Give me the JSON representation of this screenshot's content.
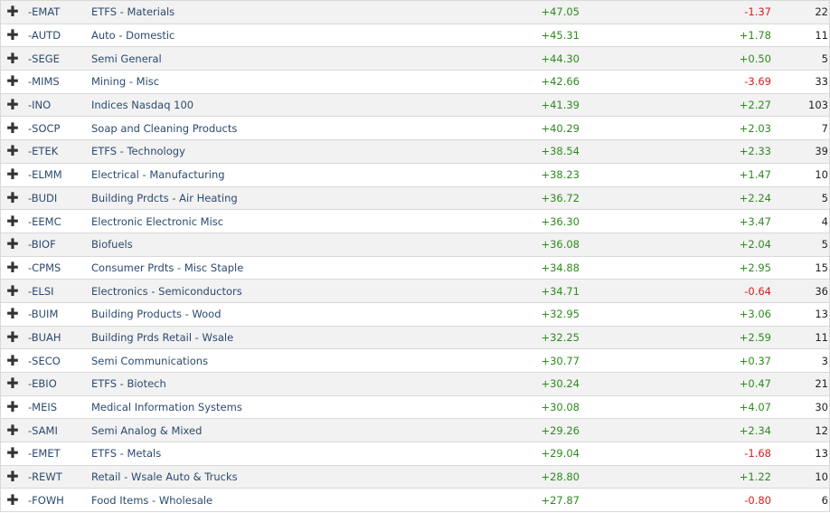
{
  "rows": [
    {
      "symbol": "-EMAT",
      "name": "ETFS - Materials",
      "chg1": "+47.05",
      "chg2": "-1.37",
      "count": "22"
    },
    {
      "symbol": "-AUTD",
      "name": "Auto - Domestic",
      "chg1": "+45.31",
      "chg2": "+1.78",
      "count": "11"
    },
    {
      "symbol": "-SEGE",
      "name": "Semi General",
      "chg1": "+44.30",
      "chg2": "+0.50",
      "count": "5"
    },
    {
      "symbol": "-MIMS",
      "name": "Mining - Misc",
      "chg1": "+42.66",
      "chg2": "-3.69",
      "count": "33"
    },
    {
      "symbol": "-INO",
      "name": "Indices Nasdaq 100",
      "chg1": "+41.39",
      "chg2": "+2.27",
      "count": "103"
    },
    {
      "symbol": "-SOCP",
      "name": "Soap and Cleaning Products",
      "chg1": "+40.29",
      "chg2": "+2.03",
      "count": "7"
    },
    {
      "symbol": "-ETEK",
      "name": "ETFS - Technology",
      "chg1": "+38.54",
      "chg2": "+2.33",
      "count": "39"
    },
    {
      "symbol": "-ELMM",
      "name": "Electrical - Manufacturing",
      "chg1": "+38.23",
      "chg2": "+1.47",
      "count": "10"
    },
    {
      "symbol": "-BUDI",
      "name": "Building Prdcts - Air Heating",
      "chg1": "+36.72",
      "chg2": "+2.24",
      "count": "5"
    },
    {
      "symbol": "-EEMC",
      "name": "Electronic Electronic Misc",
      "chg1": "+36.30",
      "chg2": "+3.47",
      "count": "4"
    },
    {
      "symbol": "-BIOF",
      "name": "Biofuels",
      "chg1": "+36.08",
      "chg2": "+2.04",
      "count": "5"
    },
    {
      "symbol": "-CPMS",
      "name": "Consumer Prdts - Misc Staple",
      "chg1": "+34.88",
      "chg2": "+2.95",
      "count": "15"
    },
    {
      "symbol": "-ELSI",
      "name": "Electronics - Semiconductors",
      "chg1": "+34.71",
      "chg2": "-0.64",
      "count": "36"
    },
    {
      "symbol": "-BUIM",
      "name": "Building Products - Wood",
      "chg1": "+32.95",
      "chg2": "+3.06",
      "count": "13"
    },
    {
      "symbol": "-BUAH",
      "name": "Building Prds Retail - Wsale",
      "chg1": "+32.25",
      "chg2": "+2.59",
      "count": "11"
    },
    {
      "symbol": "-SECO",
      "name": "Semi Communications",
      "chg1": "+30.77",
      "chg2": "+0.37",
      "count": "3"
    },
    {
      "symbol": "-EBIO",
      "name": "ETFS - Biotech",
      "chg1": "+30.24",
      "chg2": "+0.47",
      "count": "21"
    },
    {
      "symbol": "-MEIS",
      "name": "Medical Information Systems",
      "chg1": "+30.08",
      "chg2": "+4.07",
      "count": "30"
    },
    {
      "symbol": "-SAMI",
      "name": "Semi Analog & Mixed",
      "chg1": "+29.26",
      "chg2": "+2.34",
      "count": "12"
    },
    {
      "symbol": "-EMET",
      "name": "ETFS - Metals",
      "chg1": "+29.04",
      "chg2": "-1.68",
      "count": "13"
    },
    {
      "symbol": "-REWT",
      "name": "Retail - Wsale Auto & Trucks",
      "chg1": "+28.80",
      "chg2": "+1.22",
      "count": "10"
    },
    {
      "symbol": "-FOWH",
      "name": "Food Items - Wholesale",
      "chg1": "+27.87",
      "chg2": "-0.80",
      "count": "6"
    }
  ],
  "icons": {
    "expand": "plus-icon",
    "expand_glyph": "✚"
  },
  "colors": {
    "positive": "#2e8b1f",
    "negative": "#d42020",
    "text": "#2c4a6e"
  }
}
